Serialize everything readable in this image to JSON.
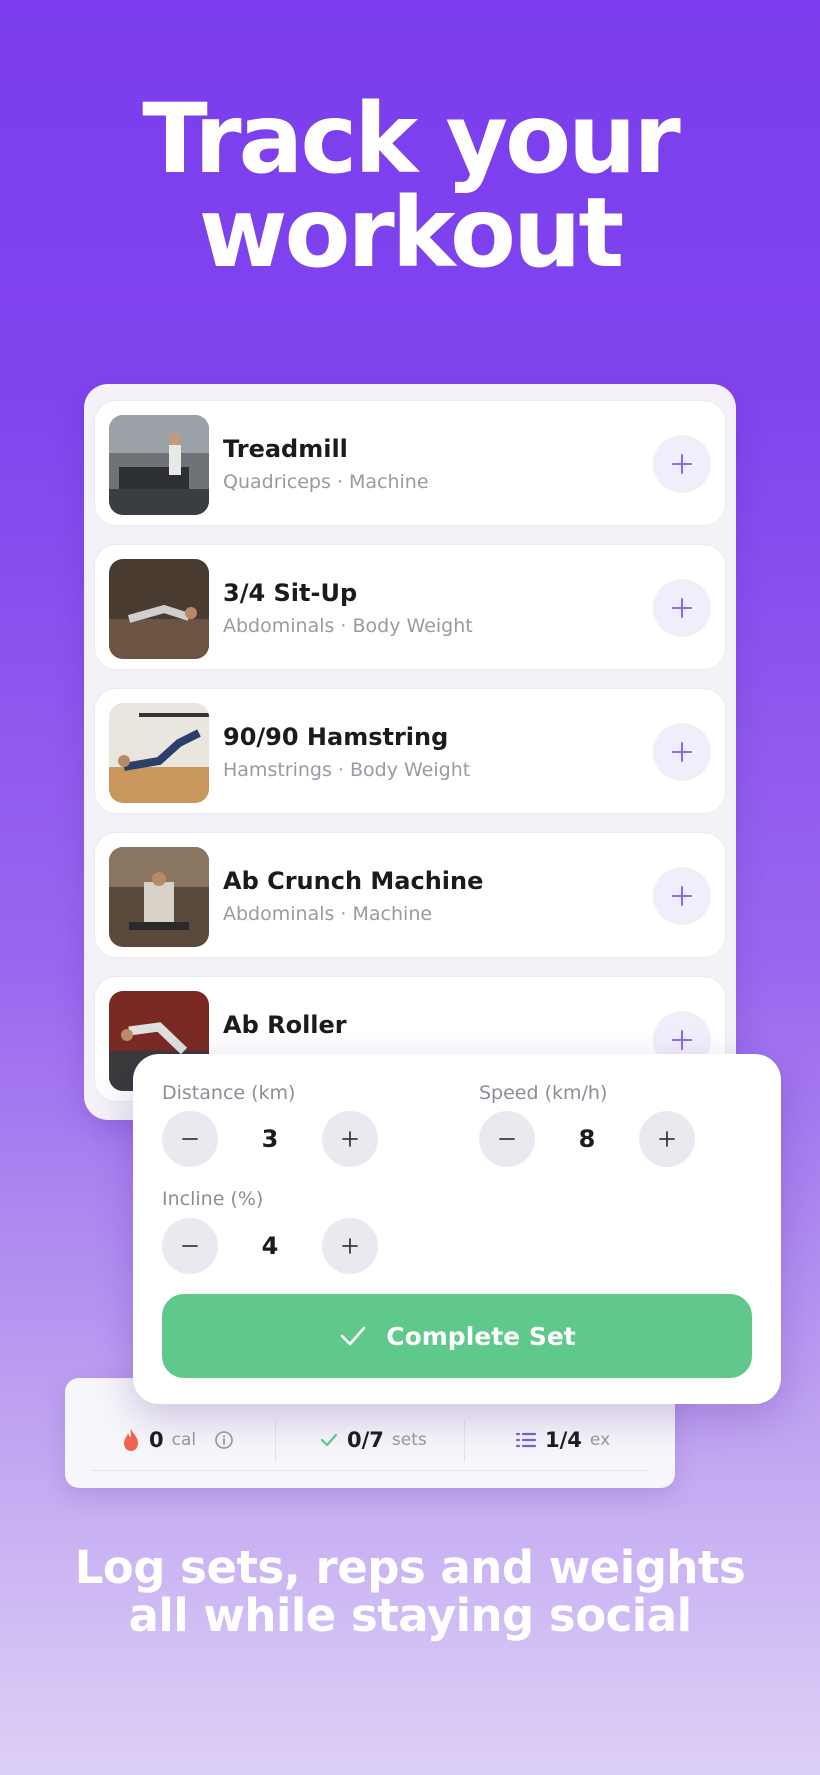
{
  "headline": {
    "line1": "Track your",
    "line2": "workout"
  },
  "exercises": [
    {
      "name": "Treadmill",
      "subtitle": "Quadriceps · Machine"
    },
    {
      "name": "3/4 Sit-Up",
      "subtitle": "Abdominals · Body Weight"
    },
    {
      "name": "90/90 Hamstring",
      "subtitle": "Hamstrings · Body Weight"
    },
    {
      "name": "Ab Crunch Machine",
      "subtitle": "Abdominals · Machine"
    },
    {
      "name": "Ab Roller",
      "subtitle": ""
    }
  ],
  "set_editor": {
    "distance": {
      "label": "Distance (km)",
      "value": "3"
    },
    "speed": {
      "label": "Speed (km/h)",
      "value": "8"
    },
    "incline": {
      "label": "Incline (%)",
      "value": "4"
    },
    "complete_label": "Complete Set"
  },
  "stats": {
    "calories": {
      "value": "0",
      "unit": "cal"
    },
    "sets": {
      "value": "0/7",
      "unit": "sets"
    },
    "exercises": {
      "value": "1/4",
      "unit": "ex"
    }
  },
  "tagline": {
    "line1": "Log sets, reps and weights",
    "line2": "all while staying social"
  },
  "colors": {
    "accent": "#7b3ded",
    "complete": "#5ec98a",
    "add_icon": "#8a6be8",
    "flame": "#f2644f"
  }
}
